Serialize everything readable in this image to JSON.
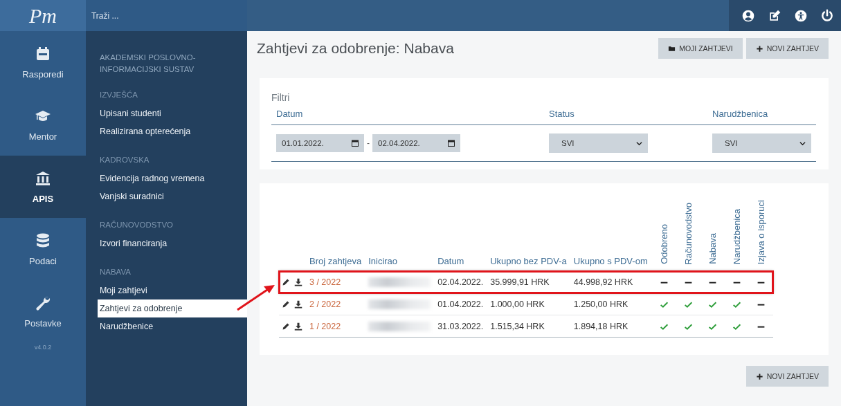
{
  "logo": "Pm",
  "search": {
    "placeholder": "Traži ..."
  },
  "rail": [
    {
      "label": "Rasporedi",
      "selected": false
    },
    {
      "label": "Mentor",
      "selected": false
    },
    {
      "label": "APIS",
      "selected": true
    },
    {
      "label": "Podaci",
      "selected": false
    },
    {
      "label": "Postavke",
      "selected": false
    }
  ],
  "version": "v4.0.2",
  "nav_title": "AKADEMSKI POSLOVNO-INFORMACIJSKI SUSTAV",
  "nav_sections": [
    {
      "title": "IZVJEŠĆA",
      "items": [
        {
          "label": "Upisani studenti",
          "selected": false
        },
        {
          "label": "Realizirana opterećenja",
          "selected": false
        }
      ]
    },
    {
      "title": "KADROVSKA",
      "items": [
        {
          "label": "Evidencija radnog vremena",
          "selected": false
        },
        {
          "label": "Vanjski suradnici",
          "selected": false
        }
      ]
    },
    {
      "title": "RAČUNOVODSTVO",
      "items": [
        {
          "label": "Izvori financiranja",
          "selected": false
        }
      ]
    },
    {
      "title": "NABAVA",
      "items": [
        {
          "label": "Moji zahtjevi",
          "selected": false
        },
        {
          "label": "Zahtjevi za odobrenje",
          "selected": true
        },
        {
          "label": "Narudžbenice",
          "selected": false
        }
      ]
    }
  ],
  "page_title": "Zahtjevi za odobrenje: Nabava",
  "header_buttons": [
    {
      "label": "MOJI ZAHTJEVI"
    },
    {
      "label": "NOVI ZAHTJEV"
    }
  ],
  "filters": {
    "title": "Filtri",
    "date_label": "Datum",
    "date_from": "01.01.2022.",
    "date_sep": "-",
    "date_to": "02.04.2022.",
    "status_label": "Status",
    "status_value": "SVI",
    "order_label": "Narudžbenica",
    "order_value": "SVI"
  },
  "table": {
    "columns": [
      "Broj zahtjeva",
      "Inicirao",
      "Datum",
      "Ukupno bez PDV-a",
      "Ukupno s PDV-om"
    ],
    "status_columns": [
      "Odobreno",
      "Računovodstvo",
      "Nabava",
      "Narudžbenica",
      "Izjava o isporuci"
    ],
    "rows": [
      {
        "number": "3 / 2022",
        "date": "02.04.2022.",
        "net": "35.999,91 HRK",
        "gross": "44.998,92 HRK",
        "highlighted": true,
        "statuses": [
          {
            "done": false
          },
          {
            "done": false
          },
          {
            "done": false
          },
          {
            "done": false
          },
          {
            "done": false
          }
        ]
      },
      {
        "number": "2 / 2022",
        "date": "01.04.2022.",
        "net": "1.000,00 HRK",
        "gross": "1.250,00 HRK",
        "highlighted": false,
        "statuses": [
          {
            "done": true
          },
          {
            "done": true
          },
          {
            "done": true
          },
          {
            "done": true
          },
          {
            "done": false
          }
        ]
      },
      {
        "number": "1 / 2022",
        "date": "31.03.2022.",
        "net": "1.515,34 HRK",
        "gross": "1.894,18 HRK",
        "highlighted": false,
        "statuses": [
          {
            "done": true
          },
          {
            "done": true
          },
          {
            "done": true
          },
          {
            "done": true
          },
          {
            "done": false
          }
        ]
      }
    ]
  },
  "footer_button": {
    "label": "NOVI ZAHTJEV"
  }
}
